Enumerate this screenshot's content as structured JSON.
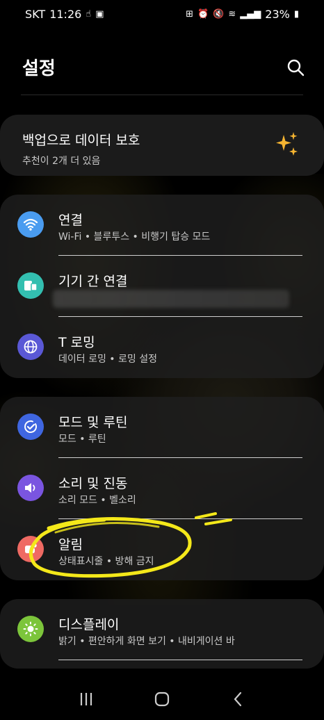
{
  "status_bar": {
    "carrier": "SKT",
    "time": "11:26",
    "battery": "23%"
  },
  "header": {
    "title": "설정",
    "search_icon": "search-icon"
  },
  "backup": {
    "title": "백업으로 데이터 보호",
    "subtitle": "추천이 2개 더 있음",
    "icon": "sparkle-icon"
  },
  "groups": [
    {
      "items": [
        {
          "title": "연결",
          "subtitle": "Wi-Fi  •  블루투스  •  비행기 탑승 모드",
          "icon": "wifi-icon",
          "color": "#4a9cf0"
        },
        {
          "title": "기기 간 연결",
          "subtitle": "",
          "icon": "devices-icon",
          "color": "#33bfb0"
        },
        {
          "title": "T 로밍",
          "subtitle": "데이터 로밍  •  로밍 설정",
          "icon": "globe-icon",
          "color": "#5a58d6"
        }
      ]
    },
    {
      "items": [
        {
          "title": "모드 및 루틴",
          "subtitle": "모드  •  루틴",
          "icon": "routine-check-icon",
          "color": "#3f66e0"
        },
        {
          "title": "소리 및 진동",
          "subtitle": "소리 모드  •  벨소리",
          "icon": "speaker-icon",
          "color": "#7a55e0"
        },
        {
          "title": "알림",
          "subtitle": "상태표시줄  •  방해 금지",
          "icon": "notification-icon",
          "color": "#ef6a63"
        }
      ]
    },
    {
      "items": [
        {
          "title": "디스플레이",
          "subtitle": "밝기  •  편안하게 화면 보기  •  내비게이션 바",
          "icon": "sun-icon",
          "color": "#7cc53b"
        }
      ]
    }
  ],
  "annotation": {
    "color": "#f4e81a"
  },
  "nav": {
    "recents_icon": "recents-icon",
    "home_icon": "home-icon",
    "back_icon": "back-icon"
  }
}
